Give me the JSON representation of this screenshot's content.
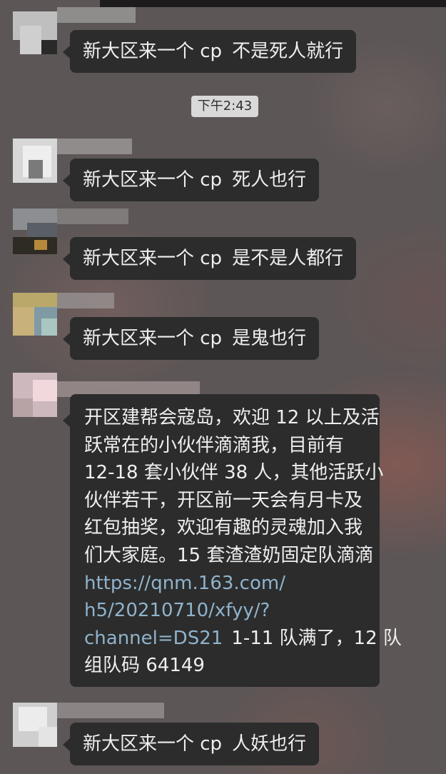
{
  "messages": [
    {
      "text": "新大区来一个 cp",
      "suffix": "不是死人就行"
    },
    {
      "text": "新大区来一个 cp",
      "suffix": "死人也行"
    },
    {
      "text": "新大区来一个 cp",
      "suffix": "是不是人都行"
    },
    {
      "text": "新大区来一个 cp",
      "suffix": "是鬼也行"
    },
    {
      "text": "新大区来一个 cp",
      "suffix": "人妖也行"
    }
  ],
  "timestamp": "下午2:43",
  "long_message": {
    "lines": [
      "开区建帮会寇岛，欢迎 12 以上及活",
      "跃常在的小伙伴滴滴我，目前有",
      "12-18 套小伙伴 38 人，其他活跃小",
      "伙伴若干，开区前一天会有月卡及",
      "红包抽奖，欢迎有趣的灵魂加入我",
      "们大家庭。15 套渣渣奶固定队滴滴"
    ],
    "link_lines": [
      "https://qnm.163.com/",
      "h5/20210710/xfyy/?",
      "channel=DS21"
    ],
    "after_link": "1-11 队满了，12 队",
    "last_line": "组队码 64149",
    "link_color": "#8fb3cc"
  },
  "colors": {
    "bubble": "#2c2c2c",
    "bubble_text": "#efefef",
    "chip": "#d9d9d9"
  }
}
